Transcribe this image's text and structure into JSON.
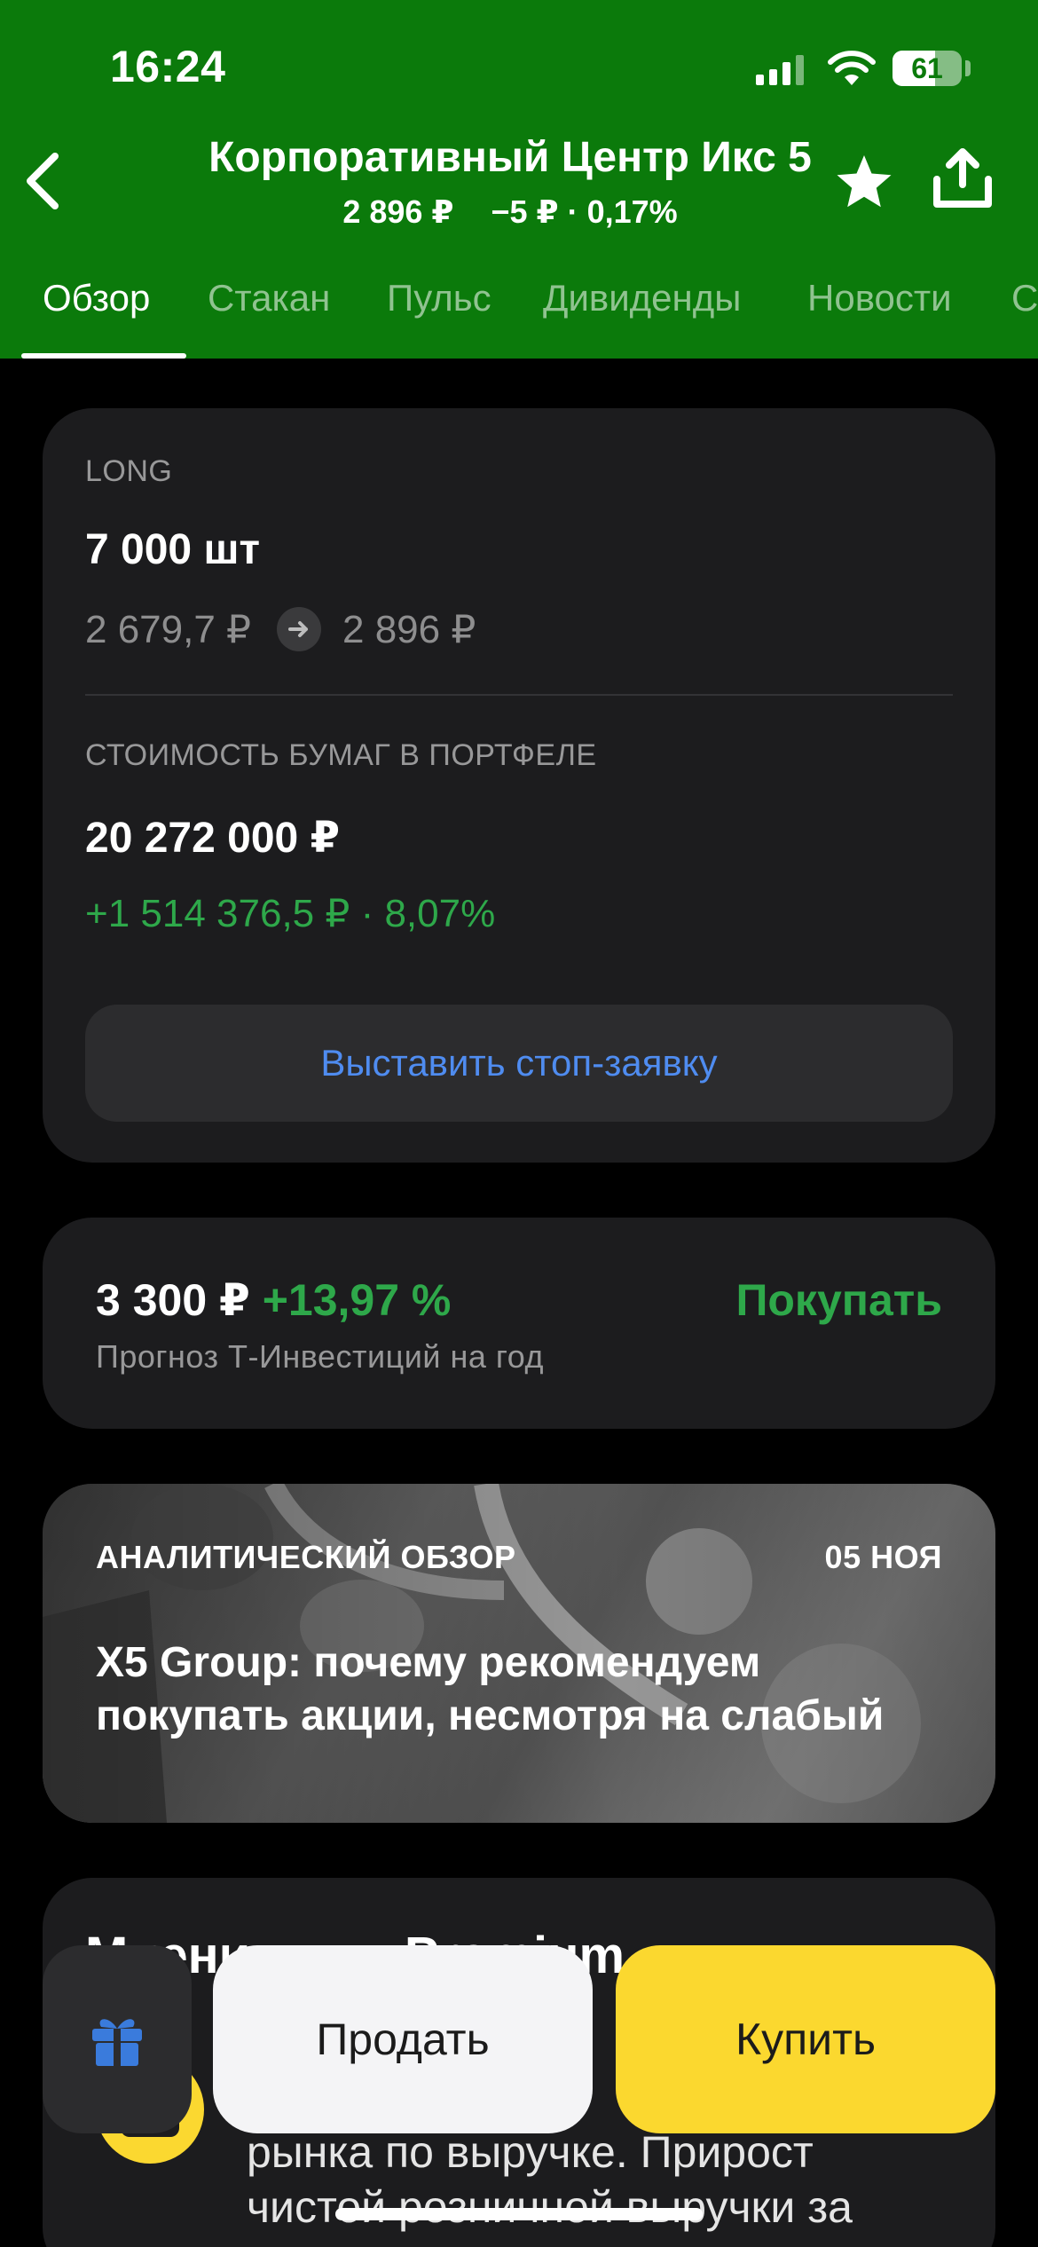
{
  "status_bar": {
    "time": "16:24",
    "battery": "61"
  },
  "header": {
    "title": "Корпоративный Центр Икс 5",
    "price": "2 896 ₽",
    "change": "−5 ₽ · 0,17%"
  },
  "tabs": [
    {
      "label": "Обзор",
      "active": true
    },
    {
      "label": "Стакан"
    },
    {
      "label": "Пульс"
    },
    {
      "label": "Дивиденды"
    },
    {
      "label": "Новости"
    },
    {
      "label": "С"
    }
  ],
  "position": {
    "direction": "LONG",
    "quantity": "7 000 шт",
    "avg_price": "2 679,7 ₽",
    "current_price": "2 896 ₽",
    "value_label": "СТОИМОСТЬ БУМАГ В ПОРТФЕЛЕ",
    "value": "20 272 000 ₽",
    "profit": "+1 514 376,5 ₽ · 8,07%",
    "stop_order_button": "Выставить стоп-заявку"
  },
  "forecast": {
    "target_price": "3 300 ₽",
    "upside": "+13,97 %",
    "recommendation": "Покупать",
    "caption": "Прогноз Т-Инвестиций на год"
  },
  "analytics": {
    "label": "АНАЛИТИЧЕСКИЙ ОБЗОР",
    "date": "05 НОЯ",
    "headline_line1": "X5 Group: почему рекомендуем",
    "headline_line2": "покупать акции, несмотря на слабый"
  },
  "premium": {
    "title": "Мнения для Premium",
    "text_line1": "рынка по выручке. Прирост",
    "text_line2": "чистой розничной выручки за"
  },
  "actions": {
    "sell": "Продать",
    "buy": "Купить"
  },
  "colors": {
    "header_green": "#0b7a0b",
    "positive_green": "#2ea84a",
    "link_blue": "#4f8cf0",
    "buy_yellow": "#fbd82f"
  }
}
